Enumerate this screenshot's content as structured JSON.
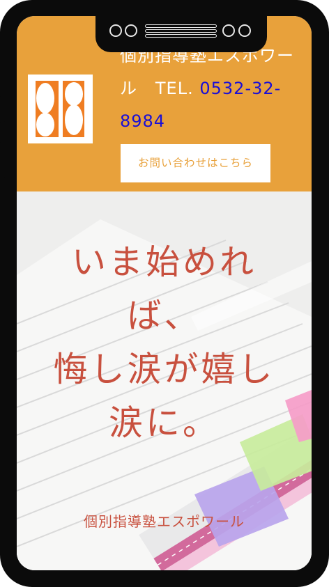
{
  "header": {
    "site_name": "個別指導塾エスポワール",
    "tel_label": "TEL.",
    "tel_number": "0532-32-8984",
    "contact_button": "お問い合わせはこちら",
    "logo_icon": "espoir-logo-icon"
  },
  "hero": {
    "headline": [
      "いま始めれ",
      "ば、",
      "悔し涙が嬉し",
      "涙に。"
    ],
    "subtitle": "個別指導塾エスポワール"
  },
  "colors": {
    "header_bg": "#e8a13b",
    "tel_link": "#1a0fd6",
    "headline": "#c8503e"
  }
}
